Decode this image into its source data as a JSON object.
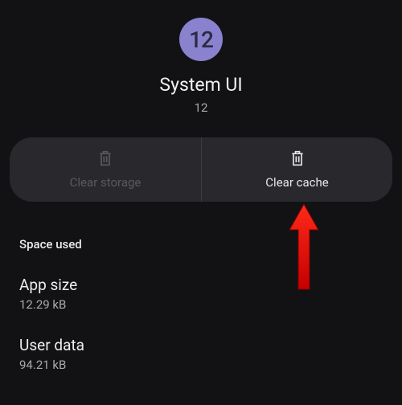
{
  "header": {
    "icon_label": "12",
    "app_name": "System UI",
    "app_version": "12"
  },
  "actions": {
    "clear_storage": "Clear storage",
    "clear_cache": "Clear cache"
  },
  "section_title": "Space used",
  "stats": {
    "app_size_label": "App size",
    "app_size_value": "12.29 kB",
    "user_data_label": "User data",
    "user_data_value": "94.21 kB"
  },
  "colors": {
    "accent": "#8a82cf",
    "bg": "#121215",
    "button_bg": "#29292d"
  }
}
